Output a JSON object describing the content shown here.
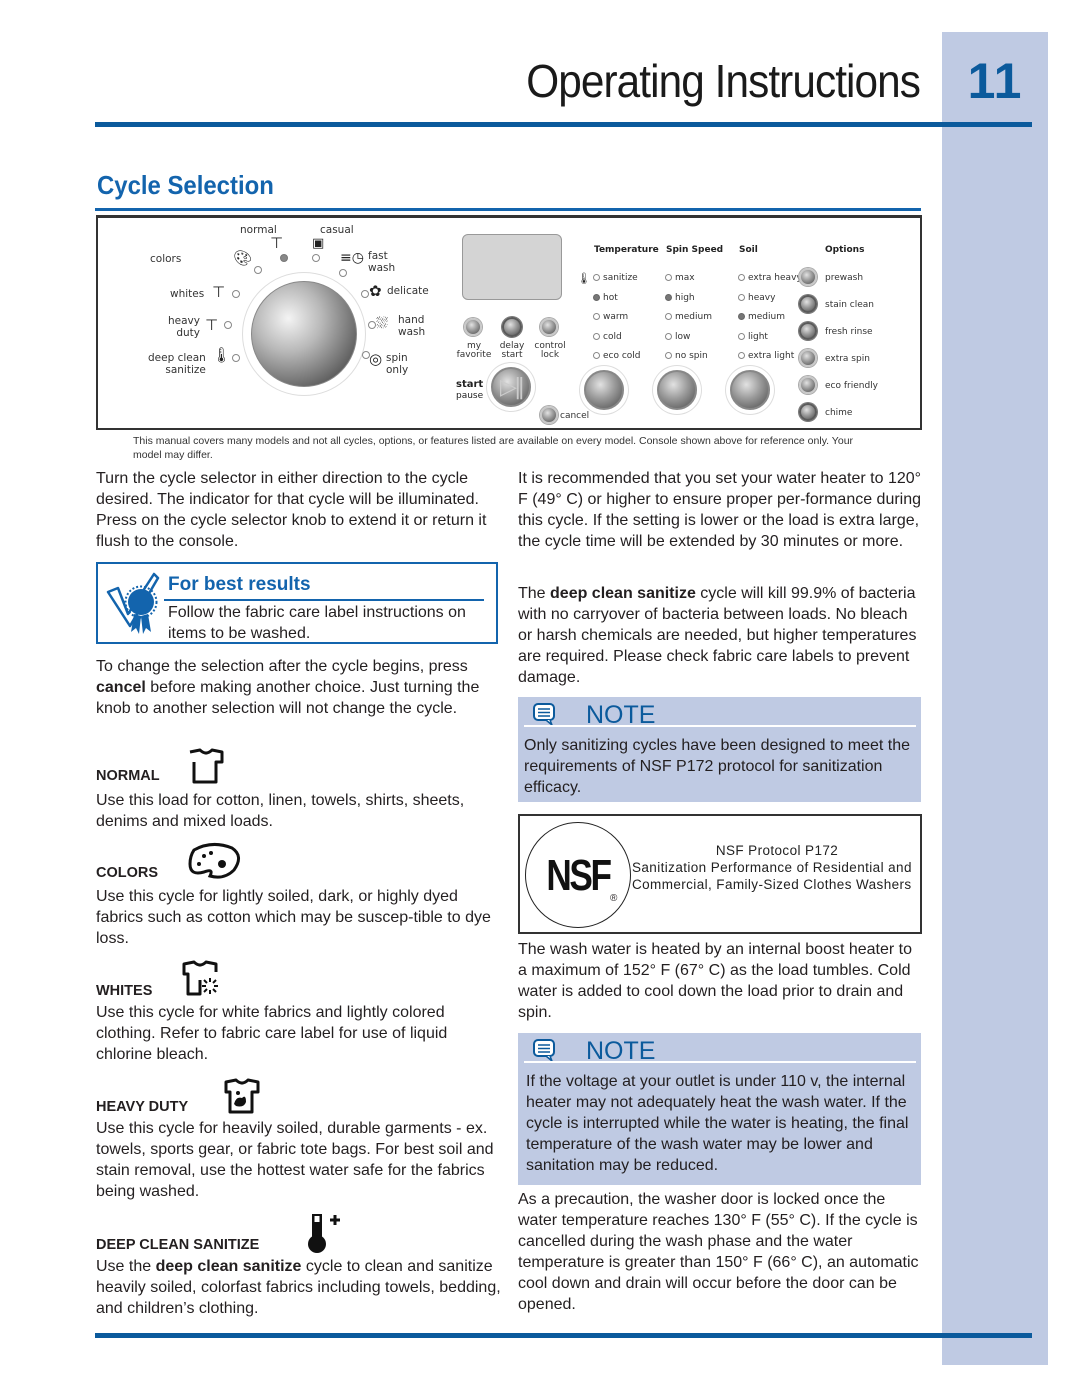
{
  "header": {
    "title": "Operating Instructions",
    "page_number": "11"
  },
  "section": {
    "title": "Cycle Selection"
  },
  "console": {
    "cycles": [
      {
        "label": "normal",
        "icon": "shirt-icon",
        "selected": true
      },
      {
        "label": "casual",
        "icon": "casual-shirt-icon",
        "selected": false
      },
      {
        "label": "fast\nwash",
        "icon": "fast-clock-icon",
        "selected": false
      },
      {
        "label": "delicate",
        "icon": "flower-icon",
        "selected": false
      },
      {
        "label": "hand\nwash",
        "icon": "hand-wash-icon",
        "selected": false
      },
      {
        "label": "spin\nonly",
        "icon": "spin-icon",
        "selected": false
      },
      {
        "label": "deep clean\nsanitize",
        "icon": "thermometer-plus-icon",
        "selected": false
      },
      {
        "label": "heavy\nduty",
        "icon": "heavy-shirt-icon",
        "selected": false
      },
      {
        "label": "whites",
        "icon": "whites-shirt-icon",
        "selected": false
      },
      {
        "label": "colors",
        "icon": "palette-icon",
        "selected": false
      }
    ],
    "cycle_labels": {
      "normal": "normal",
      "casual": "casual",
      "fast_1": "fast",
      "fast_2": "wash",
      "delicate": "delicate",
      "hand_1": "hand",
      "hand_2": "wash",
      "spin_1": "spin",
      "spin_2": "only",
      "deep_1": "deep clean",
      "deep_2": "sanitize",
      "heavy_1": "heavy",
      "heavy_2": "duty",
      "whites": "whites",
      "colors": "colors"
    },
    "buttons": {
      "my_favorite_1": "my",
      "my_favorite_2": "favorite",
      "delay_start_1": "delay",
      "delay_start_2": "start",
      "control_lock_1": "control",
      "control_lock_2": "lock",
      "start": "start",
      "pause": "pause",
      "cancel": "cancel"
    },
    "columns": {
      "temperature": {
        "header": "Temperature",
        "options": [
          {
            "label": "sanitize",
            "selected": false
          },
          {
            "label": "hot",
            "selected": true
          },
          {
            "label": "warm",
            "selected": false
          },
          {
            "label": "cold",
            "selected": false
          },
          {
            "label": "eco cold",
            "selected": false
          }
        ]
      },
      "spin_speed": {
        "header": "Spin Speed",
        "options": [
          {
            "label": "max",
            "selected": false
          },
          {
            "label": "high",
            "selected": true
          },
          {
            "label": "medium",
            "selected": false
          },
          {
            "label": "low",
            "selected": false
          },
          {
            "label": "no spin",
            "selected": false
          }
        ]
      },
      "soil": {
        "header": "Soil",
        "options": [
          {
            "label": "extra heavy",
            "selected": false
          },
          {
            "label": "heavy",
            "selected": false
          },
          {
            "label": "medium",
            "selected": true
          },
          {
            "label": "light",
            "selected": false
          },
          {
            "label": "extra light",
            "selected": false
          }
        ]
      },
      "options": {
        "header": "Options",
        "items": [
          "prewash",
          "stain clean",
          "fresh rinse",
          "extra spin",
          "eco friendly",
          "chime"
        ]
      }
    }
  },
  "disclaimer": "This manual covers many models and not all cycles, options, or features listed are available on every model. Console shown above for reference only. Your model may differ.",
  "left": {
    "intro": "Turn the cycle selector in either direction to the cycle desired. The indicator for that cycle will be illuminated. Press on the cycle selector knob to extend it or return it flush to the console.",
    "best_results": {
      "title": "For best results",
      "text": "Follow the fabric care label instructions on items to be washed."
    },
    "change_pre": "To change the selection after the cycle begins, press ",
    "change_bold": "cancel",
    "change_post": " before making another choice. Just turning the knob to another selection will not change the cycle.",
    "cycles": [
      {
        "heading": "NORMAL",
        "icon": "shirt-icon",
        "text": "Use this load for cotton, linen, towels, shirts, sheets, denims and mixed loads."
      },
      {
        "heading": "COLORS",
        "icon": "palette-icon",
        "text": "Use this cycle for lightly soiled, dark, or highly dyed fabrics such as cotton which may be suscep-tible to dye loss."
      },
      {
        "heading": "WHITES",
        "icon": "whites-shirt-icon",
        "text": "Use this cycle for white fabrics and lightly colored clothing. Refer to fabric care label for use of liquid chlorine bleach."
      },
      {
        "heading": "HEAVY DUTY",
        "icon": "heavy-shirt-icon",
        "text": "Use this cycle for heavily soiled, durable garments - ex. towels, sports gear, or fabric tote bags. For best soil and stain removal, use the hottest water safe for the fabrics being washed."
      },
      {
        "heading": "DEEP CLEAN SANITIZE",
        "icon": "thermometer-plus-icon",
        "text_pre": "Use the ",
        "text_bold": "deep clean sanitize",
        "text_post": " cycle to clean and sanitize heavily soiled, colorfast fabrics including towels, bedding, and children’s clothing."
      }
    ]
  },
  "right": {
    "para1": "It is recommended that you set your water heater to 120° F (49° C) or higher to ensure proper per-formance during this cycle. If the setting is lower or the load is extra large, the cycle time will be extended by 30 minutes or more.",
    "para2_pre": "The ",
    "para2_bold": "deep clean sanitize",
    "para2_post": " cycle will kill 99.9% of bacteria with no carryover of bacteria between loads. No bleach or harsh chemicals are needed, but higher temperatures are required. Please check fabric care labels to prevent damage.",
    "note1": {
      "title": "NOTE",
      "text": "Only sanitizing cycles have been designed to meet the requirements of NSF P172 protocol for sanitization efficacy."
    },
    "nsf": {
      "logo": "NSF",
      "registered": "®",
      "line1": "NSF Protocol P172",
      "line2": "Sanitization Performance of Residential and Commercial, Family-Sized Clothes Washers"
    },
    "para3": "The wash water is heated by an internal boost heater to a maximum of 152° F (67° C) as the load tumbles. Cold water is added to cool down the load prior to drain and spin.",
    "note2": {
      "title": "NOTE",
      "text": "If the voltage at your outlet is under 110 v, the internal heater may not adequately heat the wash water. If the cycle is interrupted while the water is heating, the final temperature of the wash water may be lower and sanitation may be reduced."
    },
    "para4": "As a precaution, the washer door is locked once the water temperature reaches 130° F (55° C). If the cycle is cancelled during the wash phase and the water temperature is greater than 150° F (66° C), an automatic cool down and drain will occur before the door can be opened."
  },
  "colors": {
    "brand_blue": "#0b5a9c",
    "heading_blue": "#1364ad",
    "band": "#bfcae3"
  }
}
